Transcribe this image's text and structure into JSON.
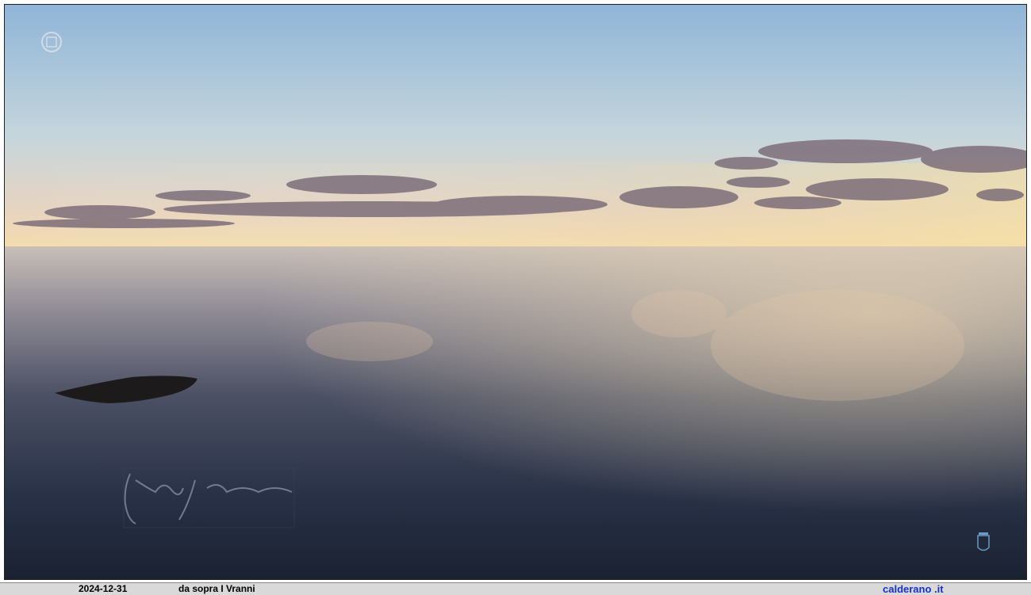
{
  "photo": {
    "description_icons": [
      "crest-icon",
      "coat-of-arms-icon",
      "signature-mark"
    ],
    "colors": {
      "sky_top": "#8fb7d8",
      "sky_horizon": "#f3dcb0",
      "sea_near": "#1d2638",
      "sea_far": "#d8c8b0"
    }
  },
  "footer": {
    "date": "2024-12-31",
    "place": "da sopra I Vranni",
    "site": "calderano .it"
  }
}
